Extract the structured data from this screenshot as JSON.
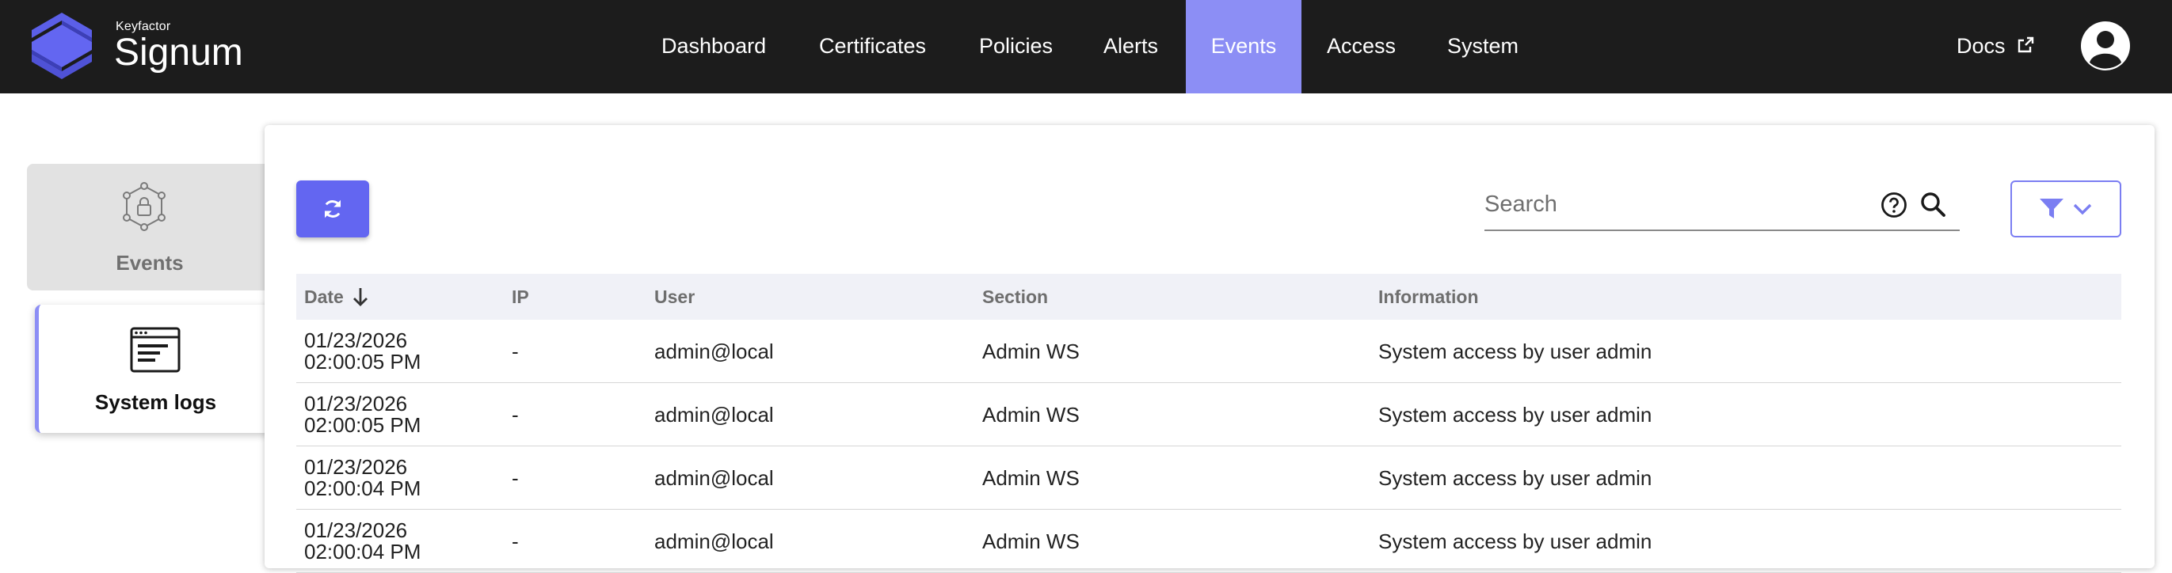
{
  "brand": {
    "company": "Keyfactor",
    "product": "Signum"
  },
  "nav": {
    "items": [
      {
        "label": "Dashboard"
      },
      {
        "label": "Certificates"
      },
      {
        "label": "Policies"
      },
      {
        "label": "Alerts"
      },
      {
        "label": "Events"
      },
      {
        "label": "Access"
      },
      {
        "label": "System"
      }
    ],
    "active": "Events",
    "docs_label": "Docs"
  },
  "sidebar": {
    "items": [
      {
        "label": "Events",
        "icon": "network-lock-icon"
      },
      {
        "label": "System logs",
        "icon": "log-window-icon"
      }
    ],
    "active": "System logs"
  },
  "toolbar": {
    "refresh_icon": "refresh-icon",
    "search_placeholder": "Search",
    "search_value": "",
    "filter_icon": "filter-icon"
  },
  "table": {
    "columns": [
      "Date",
      "IP",
      "User",
      "Section",
      "Information"
    ],
    "sort_column": "Date",
    "sort_direction": "descending",
    "rows": [
      {
        "date": "01/23/2026 02:00:05 PM",
        "ip": "-",
        "user": "admin@local",
        "section": "Admin WS",
        "info": "System access by user admin"
      },
      {
        "date": "01/23/2026 02:00:05 PM",
        "ip": "-",
        "user": "admin@local",
        "section": "Admin WS",
        "info": "System access by user admin"
      },
      {
        "date": "01/23/2026 02:00:04 PM",
        "ip": "-",
        "user": "admin@local",
        "section": "Admin WS",
        "info": "System access by user admin"
      },
      {
        "date": "01/23/2026 02:00:04 PM",
        "ip": "-",
        "user": "admin@local",
        "section": "Admin WS",
        "info": "System access by user admin"
      }
    ]
  },
  "colors": {
    "topbar": "#1c1c1c",
    "accent": "#6366f1",
    "active_tab": "#8c8ef5"
  }
}
